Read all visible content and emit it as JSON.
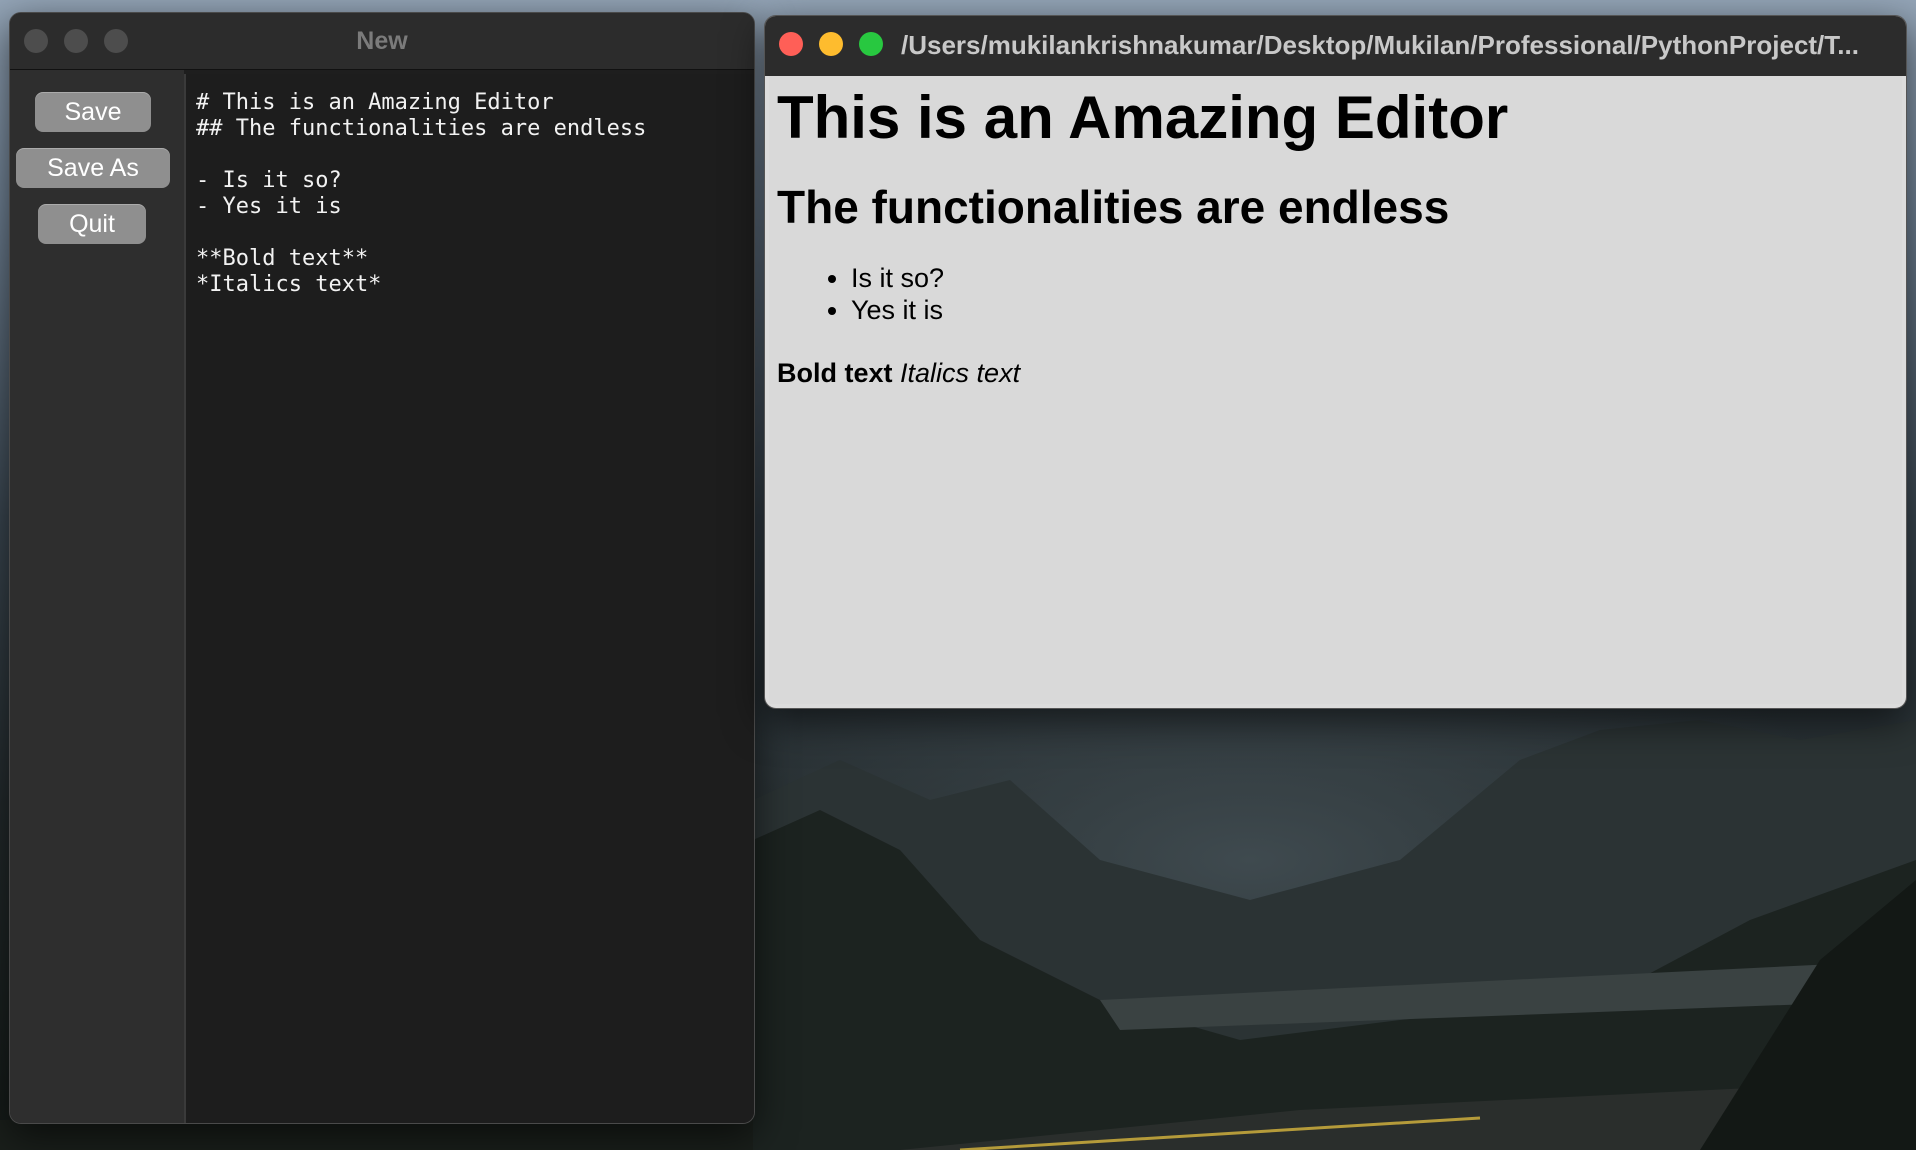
{
  "editor_window": {
    "title": "New",
    "buttons": {
      "save": "Save",
      "save_as": "Save As",
      "quit": "Quit"
    },
    "content": "# This is an Amazing Editor\n## The functionalities are endless\n\n- Is it so?\n- Yes it is\n\n**Bold text**\n*Italics text*"
  },
  "preview_window": {
    "title": "/Users/mukilankrishnakumar/Desktop/Mukilan/Professional/PythonProject/T...",
    "h1": "This is an Amazing Editor",
    "h2": "The functionalities are endless",
    "list": [
      "Is it so?",
      "Yes it is"
    ],
    "bold_text": "Bold text",
    "italic_text": "Italics text"
  },
  "colors": {
    "close": "#ff5f57",
    "minimize": "#febc2e",
    "zoom": "#28c840",
    "button_bg": "#8f8f8f",
    "editor_bg": "#1d1d1d",
    "preview_bg": "#d9d9d9"
  }
}
